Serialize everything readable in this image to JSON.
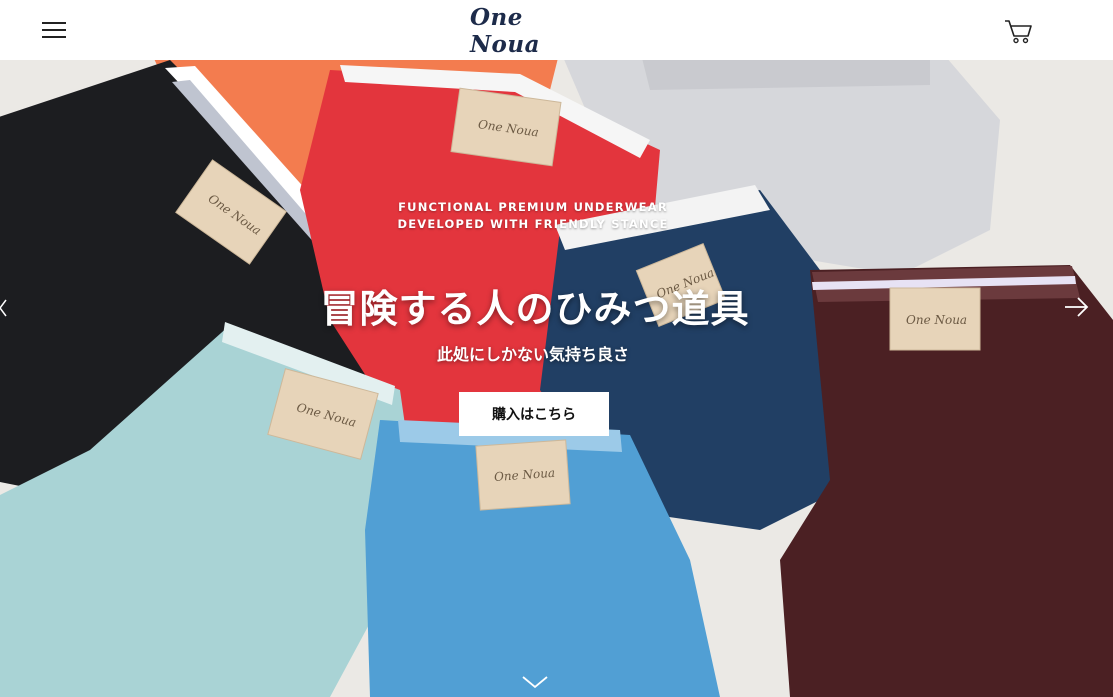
{
  "header": {
    "logo_text": "One Noua",
    "menu_icon": "hamburger-menu-icon",
    "cart_icon": "shopping-cart-icon"
  },
  "hero": {
    "tagline_line1": "FUNCTIONAL PREMIUM UNDERWEAR",
    "tagline_line2": "DEVELOPED WITH FRIENDLY STANCE",
    "title": "冒険する人のひみつ道具",
    "subtitle": "此処にしかない気持ち良さ",
    "cta_label": "購入はこちら",
    "label_text": "One Noua",
    "next_icon": "arrow-right-icon",
    "prev_icon": "arrow-left-icon",
    "scroll_icon": "chevron-down-icon"
  },
  "colors": {
    "logo": "#1d2b4a",
    "black_item": "#1b1c1e",
    "orange_item": "#f2784b",
    "red_item": "#e0343c",
    "grey_item": "#d5d6da",
    "navy_item": "#1f3e63",
    "maroon_item": "#4a1f22",
    "mint_item": "#a8d2d4",
    "blue_item": "#4f9ed2",
    "tag": "#e6d3b8"
  }
}
